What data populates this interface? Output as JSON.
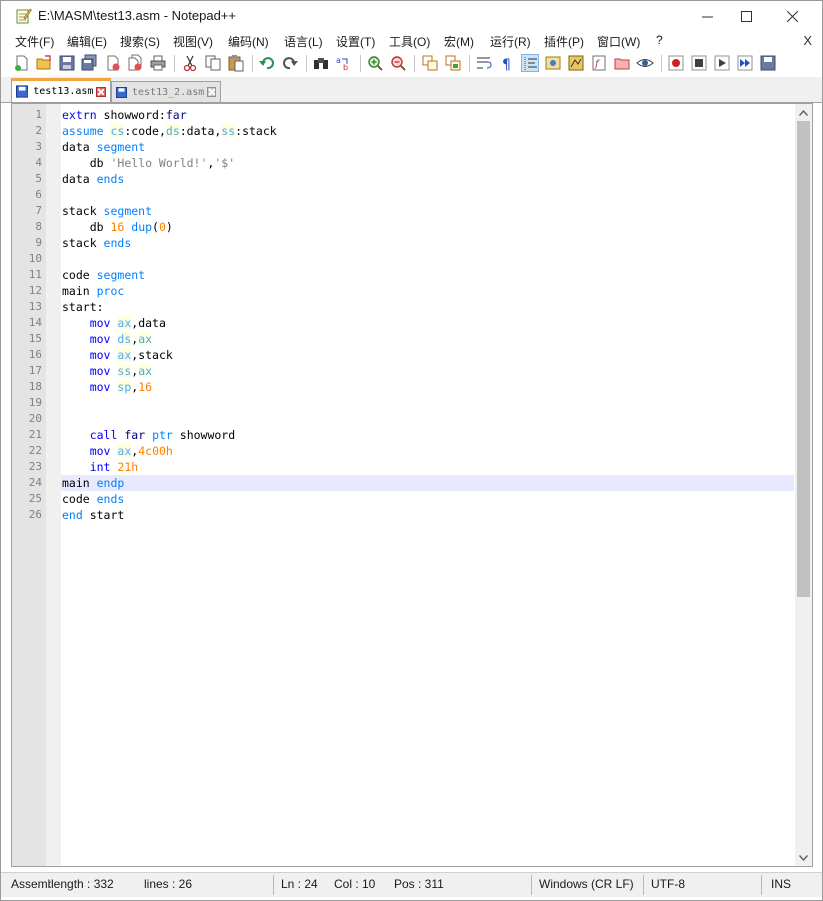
{
  "window": {
    "title": "E:\\MASM\\test13.asm - Notepad++"
  },
  "menu": {
    "items": [
      {
        "label": "文件(F)"
      },
      {
        "label": "编辑(E)"
      },
      {
        "label": "搜索(S)"
      },
      {
        "label": "视图(V)"
      },
      {
        "label": "编码(N)"
      },
      {
        "label": "语言(L)"
      },
      {
        "label": "设置(T)"
      },
      {
        "label": "工具(O)"
      },
      {
        "label": "宏(M)"
      },
      {
        "label": "运行(R)"
      },
      {
        "label": "插件(P)"
      },
      {
        "label": "窗口(W)"
      },
      {
        "label": "?"
      }
    ],
    "close_glyph": "X"
  },
  "tabs": [
    {
      "label": "test13.asm",
      "active": true
    },
    {
      "label": "test13_2.asm",
      "active": false
    }
  ],
  "editor": {
    "current_line": 24,
    "lines": [
      {
        "num": "1",
        "tokens": [
          [
            "kw",
            "extrn"
          ],
          [
            "plain",
            " showword:"
          ],
          [
            "op",
            "far"
          ]
        ]
      },
      {
        "num": "2",
        "tokens": [
          [
            "dir",
            "assume"
          ],
          [
            "plain",
            " "
          ],
          [
            "reg",
            "cs"
          ],
          [
            "plain",
            ":code,"
          ],
          [
            "reg",
            "ds"
          ],
          [
            "plain",
            ":data,"
          ],
          [
            "reg",
            "ss"
          ],
          [
            "plain",
            ":stack"
          ]
        ]
      },
      {
        "num": "3",
        "tokens": [
          [
            "plain",
            "data "
          ],
          [
            "dir",
            "segment"
          ]
        ]
      },
      {
        "num": "4",
        "tokens": [
          [
            "plain",
            "    db "
          ],
          [
            "str",
            "'Hello World!'"
          ],
          [
            "plain",
            ","
          ],
          [
            "str",
            "'$'"
          ]
        ]
      },
      {
        "num": "5",
        "tokens": [
          [
            "plain",
            "data "
          ],
          [
            "dir",
            "ends"
          ]
        ]
      },
      {
        "num": "6",
        "tokens": []
      },
      {
        "num": "7",
        "tokens": [
          [
            "plain",
            "stack "
          ],
          [
            "dir",
            "segment"
          ]
        ]
      },
      {
        "num": "8",
        "tokens": [
          [
            "plain",
            "    db "
          ],
          [
            "num",
            "16"
          ],
          [
            "plain",
            " "
          ],
          [
            "dir",
            "dup"
          ],
          [
            "plain",
            "("
          ],
          [
            "num",
            "0"
          ],
          [
            "plain",
            ")"
          ]
        ]
      },
      {
        "num": "9",
        "tokens": [
          [
            "plain",
            "stack "
          ],
          [
            "dir",
            "ends"
          ]
        ]
      },
      {
        "num": "10",
        "tokens": []
      },
      {
        "num": "11",
        "tokens": [
          [
            "plain",
            "code "
          ],
          [
            "dir",
            "segment"
          ]
        ]
      },
      {
        "num": "12",
        "tokens": [
          [
            "plain",
            "main "
          ],
          [
            "dir",
            "proc"
          ]
        ]
      },
      {
        "num": "13",
        "tokens": [
          [
            "plain",
            "start:"
          ]
        ]
      },
      {
        "num": "14",
        "tokens": [
          [
            "plain",
            "    "
          ],
          [
            "kw",
            "mov"
          ],
          [
            "plain",
            " "
          ],
          [
            "reg",
            "ax"
          ],
          [
            "plain",
            ",data"
          ]
        ]
      },
      {
        "num": "15",
        "tokens": [
          [
            "plain",
            "    "
          ],
          [
            "kw",
            "mov"
          ],
          [
            "plain",
            " "
          ],
          [
            "reg",
            "ds"
          ],
          [
            "plain",
            ","
          ],
          [
            "reg",
            "ax"
          ]
        ]
      },
      {
        "num": "16",
        "tokens": [
          [
            "plain",
            "    "
          ],
          [
            "kw",
            "mov"
          ],
          [
            "plain",
            " "
          ],
          [
            "reg",
            "ax"
          ],
          [
            "plain",
            ",stack"
          ]
        ]
      },
      {
        "num": "17",
        "tokens": [
          [
            "plain",
            "    "
          ],
          [
            "kw",
            "mov"
          ],
          [
            "plain",
            " "
          ],
          [
            "reg",
            "ss"
          ],
          [
            "plain",
            ","
          ],
          [
            "reg",
            "ax"
          ]
        ]
      },
      {
        "num": "18",
        "tokens": [
          [
            "plain",
            "    "
          ],
          [
            "kw",
            "mov"
          ],
          [
            "plain",
            " "
          ],
          [
            "reg",
            "sp"
          ],
          [
            "plain",
            ","
          ],
          [
            "num",
            "16"
          ]
        ]
      },
      {
        "num": "19",
        "tokens": []
      },
      {
        "num": "20",
        "tokens": []
      },
      {
        "num": "21",
        "tokens": [
          [
            "plain",
            "    "
          ],
          [
            "kw",
            "call"
          ],
          [
            "plain",
            " "
          ],
          [
            "op",
            "far"
          ],
          [
            "plain",
            " "
          ],
          [
            "dir",
            "ptr"
          ],
          [
            "plain",
            " showword"
          ]
        ]
      },
      {
        "num": "22",
        "tokens": [
          [
            "plain",
            "    "
          ],
          [
            "kw",
            "mov"
          ],
          [
            "plain",
            " "
          ],
          [
            "reg",
            "ax"
          ],
          [
            "plain",
            ","
          ],
          [
            "num",
            "4c00h"
          ]
        ]
      },
      {
        "num": "23",
        "tokens": [
          [
            "plain",
            "    "
          ],
          [
            "kw",
            "int"
          ],
          [
            "plain",
            " "
          ],
          [
            "num",
            "21h"
          ]
        ]
      },
      {
        "num": "24",
        "tokens": [
          [
            "plain",
            "main "
          ],
          [
            "dir",
            "endp"
          ]
        ]
      },
      {
        "num": "25",
        "tokens": [
          [
            "plain",
            "code "
          ],
          [
            "dir",
            "ends"
          ]
        ]
      },
      {
        "num": "26",
        "tokens": [
          [
            "dir",
            "end"
          ],
          [
            "plain",
            " start"
          ]
        ]
      }
    ]
  },
  "status": {
    "filetype": "Assemb",
    "length": "length : 332",
    "lines": "lines : 26",
    "ln": "Ln : 24",
    "col": "Col : 10",
    "pos": "Pos : 311",
    "eol": "Windows (CR LF)",
    "encoding": "UTF-8",
    "mode": "INS"
  },
  "colors": {
    "keyword": "#0000ff",
    "directive": "#0080ff",
    "register": "#46aaff",
    "number": "#ff8000",
    "string": "#808080",
    "current_line_bg": "#e8e8ff",
    "active_tab_accent": "#f5a442"
  }
}
